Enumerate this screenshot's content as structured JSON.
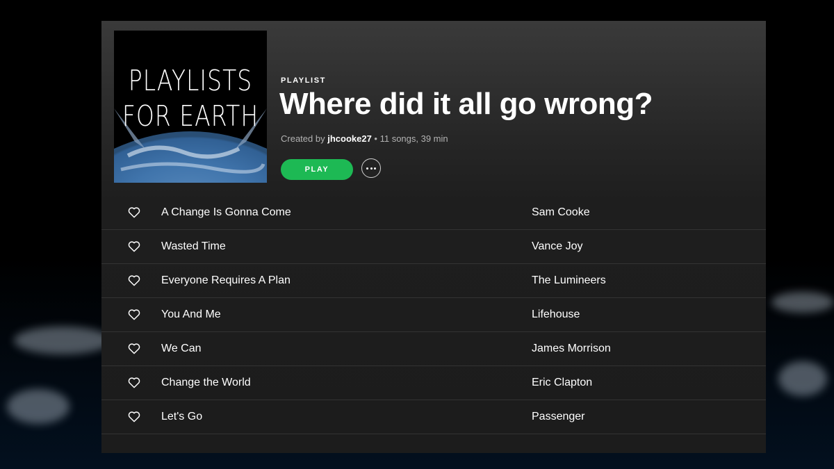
{
  "cover": {
    "line1": "PLAYLISTS",
    "line2": "FOR EARTH"
  },
  "playlist": {
    "type_label": "PLAYLIST",
    "title": "Where did it all go wrong?",
    "created_by_label": "Created by",
    "owner": "jhcooke27",
    "stats": " • 11 songs, 39 min"
  },
  "controls": {
    "play_label": "PLAY",
    "more_icon": "more-options-icon",
    "play_color": "#1db954"
  },
  "tracks": [
    {
      "name": "A Change Is Gonna Come",
      "artist": "Sam Cooke"
    },
    {
      "name": "Wasted Time",
      "artist": "Vance Joy"
    },
    {
      "name": "Everyone Requires A Plan",
      "artist": "The Lumineers"
    },
    {
      "name": "You And Me",
      "artist": "Lifehouse"
    },
    {
      "name": "We Can",
      "artist": "James Morrison"
    },
    {
      "name": "Change the World",
      "artist": "Eric Clapton"
    },
    {
      "name": "Let's Go",
      "artist": "Passenger"
    }
  ],
  "icons": {
    "save_track": "heart-icon"
  }
}
